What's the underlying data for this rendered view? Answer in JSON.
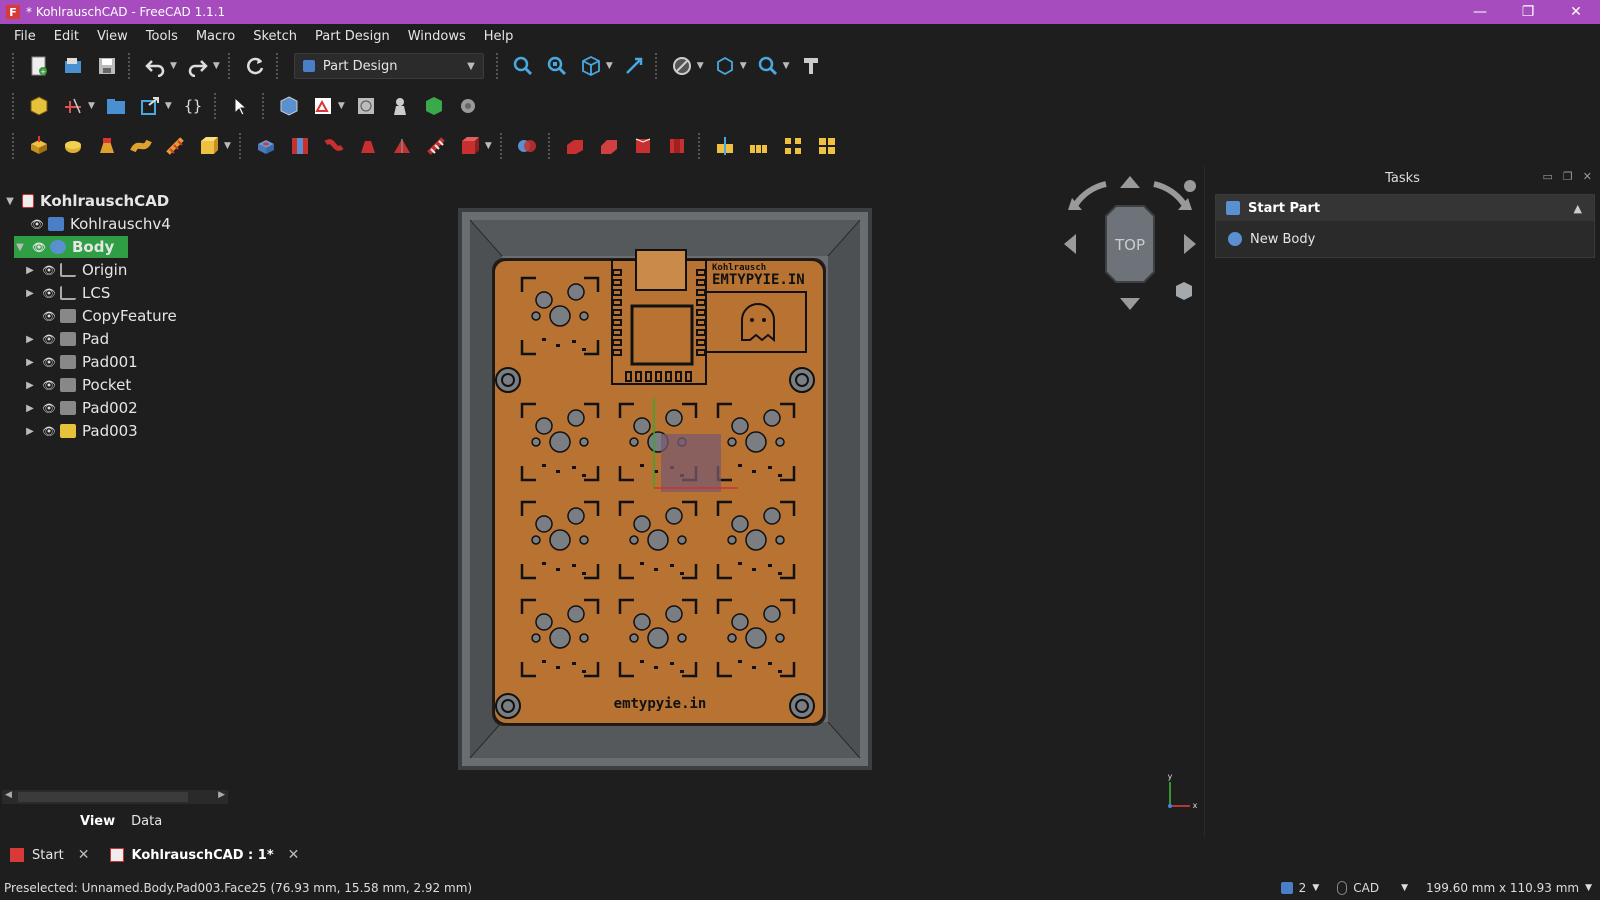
{
  "window": {
    "title": "* KohlrauschCAD - FreeCAD 1.1.1",
    "app_icon_letter": "F",
    "minimize_symbol": "—",
    "maximize_symbol": "❐",
    "close_symbol": "✕"
  },
  "menu": [
    "File",
    "Edit",
    "View",
    "Tools",
    "Macro",
    "Sketch",
    "Part Design",
    "Windows",
    "Help"
  ],
  "toolbar": {
    "workbench": "Part Design",
    "row1_icons": [
      "new-document-icon",
      "open-icon",
      "save-icon",
      "undo-icon",
      "redo-icon",
      "refresh-icon",
      "fit-all-icon",
      "fit-selection-icon",
      "isometric-view-icon",
      "sync-view-icon",
      "draw-style-icon",
      "std-views-icon",
      "measure-icon",
      "whats-this-icon"
    ],
    "row2_icons": [
      "create-part-icon",
      "create-datum-icon",
      "create-group-icon",
      "link-icon",
      "variable-set-icon",
      "select-icon",
      "create-body-icon",
      "create-sketch-icon",
      "validate-sketch-icon",
      "check-geometry-icon",
      "shape-binder-icon",
      "clone-icon"
    ],
    "row3_icons": [
      "pad-icon",
      "revolution-icon",
      "additive-loft-icon",
      "additive-pipe-icon",
      "additive-helix-icon",
      "additive-primitive-icon",
      "pocket-icon",
      "hole-icon",
      "groove-icon",
      "subtractive-loft-icon",
      "subtractive-pipe-icon",
      "subtractive-helix-icon",
      "subtractive-primitive-icon",
      "boolean-icon",
      "fillet-icon",
      "chamfer-icon",
      "draft-icon",
      "thickness-icon",
      "mirrored-icon",
      "linear-pattern-icon",
      "polar-pattern-icon",
      "multi-transform-icon"
    ]
  },
  "tree": {
    "items": [
      {
        "label": "KohlrauschCAD",
        "level": 0,
        "expanded": true,
        "eye": "",
        "icon": "document-icon",
        "bold": true
      },
      {
        "label": "Kohlrauschv4",
        "level": 1,
        "expanded": null,
        "eye": "👁",
        "icon": "part-icon"
      },
      {
        "label": "Body",
        "level": 1,
        "expanded": true,
        "eye": "👁",
        "icon": "body-icon",
        "selected": true
      },
      {
        "label": "Origin",
        "level": 2,
        "expanded": false,
        "eye": "👁",
        "icon": "origin-icon"
      },
      {
        "label": "LCS",
        "level": 2,
        "expanded": false,
        "eye": "👁",
        "icon": "lcs-icon"
      },
      {
        "label": "CopyFeature",
        "level": 2,
        "expanded": null,
        "eye": "👁",
        "icon": "feature-icon"
      },
      {
        "label": "Pad",
        "level": 2,
        "expanded": false,
        "eye": "👁",
        "icon": "pad-icon"
      },
      {
        "label": "Pad001",
        "level": 2,
        "expanded": false,
        "eye": "👁",
        "icon": "pad-icon"
      },
      {
        "label": "Pocket",
        "level": 2,
        "expanded": false,
        "eye": "👁",
        "icon": "pocket-icon"
      },
      {
        "label": "Pad002",
        "level": 2,
        "expanded": false,
        "eye": "👁",
        "icon": "pad-icon"
      },
      {
        "label": "Pad003",
        "level": 2,
        "expanded": false,
        "eye": "👁",
        "icon": "pad-active-icon"
      }
    ],
    "tabs": [
      "View",
      "Data"
    ],
    "active_tab": "View"
  },
  "viewport": {
    "board_top_text_1": "Kohlrausch",
    "board_top_text_2": "EMTYPYIE.IN",
    "board_bottom_text": "emtypyie.in",
    "navcube_label": "TOP",
    "axis_x": "x",
    "axis_y": "y"
  },
  "tasks": {
    "header": "Tasks",
    "panel_title": "Start Part",
    "action": "New Body"
  },
  "doc_tabs": [
    {
      "label": "Start",
      "active": false
    },
    {
      "label": "KohlrauschCAD : 1*",
      "active": true
    }
  ],
  "status": {
    "message": "Preselected: Unnamed.Body.Pad003.Face25 (76.93 mm, 15.58 mm, 2.92 mm)",
    "view_count": "2",
    "nav_style": "CAD",
    "dimensions": "199.60 mm x 110.93 mm"
  },
  "colors": {
    "titlebar": "#a64cbf",
    "selection": "#2f9e44",
    "board": "#b87333",
    "frame": "#55595c"
  }
}
